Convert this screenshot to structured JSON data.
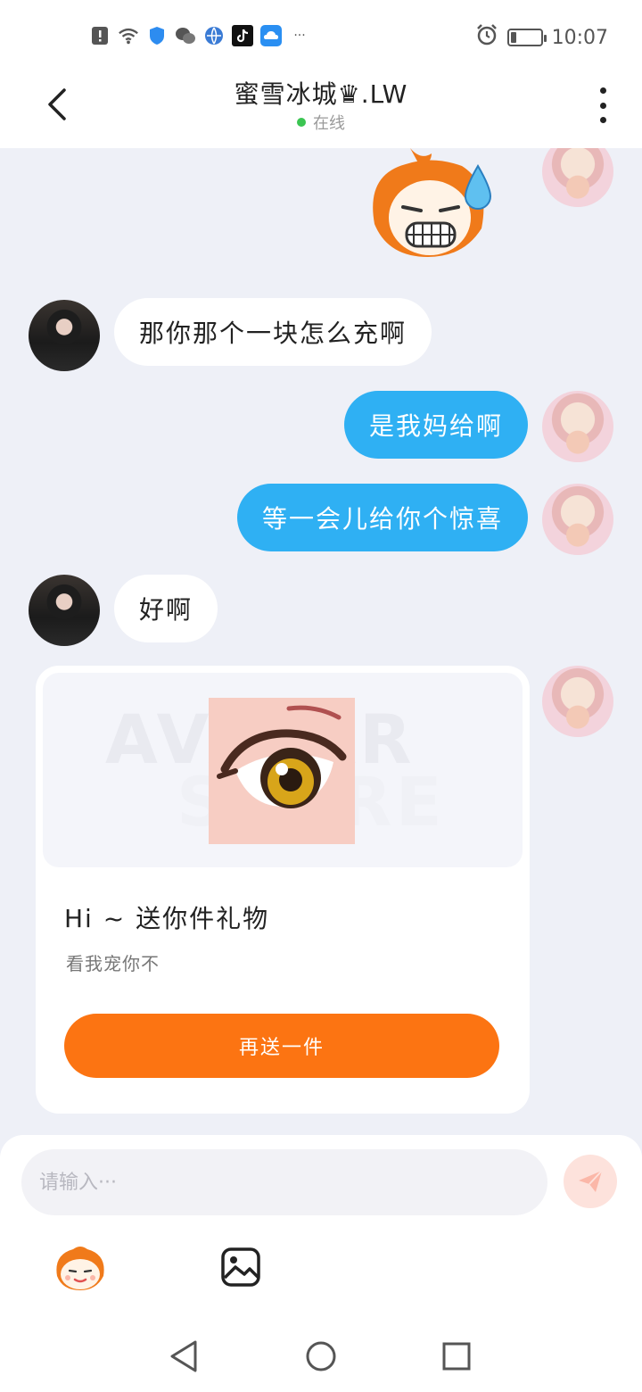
{
  "status_bar": {
    "time": "10:07",
    "icons": [
      "alert-icon",
      "wifi-icon",
      "shield-icon",
      "wechat-icon",
      "browser-icon",
      "tiktok-icon",
      "cloud-icon",
      "more-dots-icon"
    ],
    "overflow": "···",
    "battery_level": 0.2
  },
  "header": {
    "title": "蜜雪冰城♛.LW",
    "status": "在线"
  },
  "messages": [
    {
      "side": "in",
      "text": "那你那个一块怎么充啊"
    },
    {
      "side": "out",
      "text": "是我妈给啊"
    },
    {
      "side": "out",
      "text": "等一会儿给你个惊喜"
    },
    {
      "side": "in",
      "text": "好啊"
    }
  ],
  "gift": {
    "watermark_top": "AVATAR",
    "watermark_bottom": "STORE",
    "title": "Hi ~ 送你件礼物",
    "subtitle": "看我宠你不",
    "button": "再送一件"
  },
  "input": {
    "placeholder": "请输入···"
  },
  "colors": {
    "bubble_out": "#2fb0f3",
    "gift_button": "#fc7412",
    "online_dot": "#3bc552"
  }
}
